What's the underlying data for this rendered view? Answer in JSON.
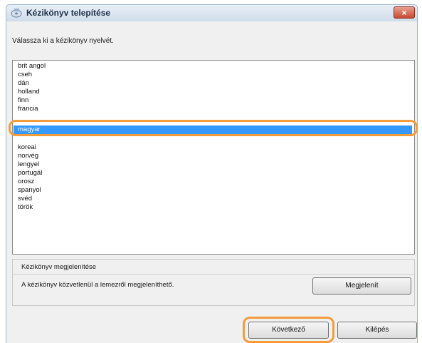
{
  "window": {
    "title": "Kézikönyv telepítése",
    "close_glyph": "×"
  },
  "instruction": "Válassza ki a kézikönyv nyelvét.",
  "languages": [
    "brit angol",
    "cseh",
    "dán",
    "holland",
    "finn",
    "francia",
    "",
    "magyar",
    "",
    "koreai",
    "norvég",
    "lengyel",
    "portugál",
    "orosz",
    "spanyol",
    "svéd",
    "török"
  ],
  "selected_language": "magyar",
  "display_group": {
    "label": "Kézikönyv megjelenítése",
    "description": "A kézikönyv közvetlenül a lemezről megjeleníthető.",
    "show_button": "Megjelenít"
  },
  "buttons": {
    "next": "Következő",
    "exit": "Kilépés"
  },
  "colors": {
    "selection": "#3399ff",
    "highlight_ring": "#f29c3c",
    "close_button": "#c64a32"
  }
}
